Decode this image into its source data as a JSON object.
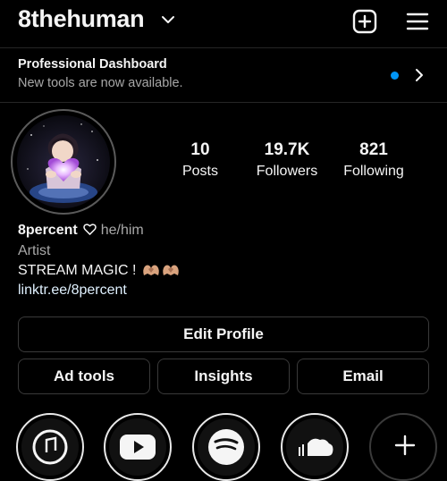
{
  "header": {
    "username": "8thehuman",
    "icons": [
      "chevron-down-icon",
      "add-icon",
      "menu-icon"
    ]
  },
  "dashboard": {
    "title": "Professional Dashboard",
    "subtitle": "New tools are now available.",
    "dot_color": "#0095f6"
  },
  "stats": [
    {
      "value": "10",
      "label": "Posts"
    },
    {
      "value": "19.7K",
      "label": "Followers"
    },
    {
      "value": "821",
      "label": "Following"
    }
  ],
  "bio": {
    "name": "8percent",
    "pronouns": "he/him",
    "category": "Artist",
    "text": "STREAM MAGIC !",
    "link": "linktr.ee/8percent"
  },
  "buttons": {
    "edit_profile": "Edit Profile",
    "ad_tools": "Ad tools",
    "insights": "Insights",
    "email": "Email"
  },
  "highlights": [
    "apple-music-icon",
    "youtube-icon",
    "spotify-icon",
    "soundcloud-icon",
    "new-highlight-icon"
  ],
  "colors": {
    "background": "#000000",
    "text": "#f5f5f5",
    "secondary": "#a8a8a8",
    "link": "#e0f1ff",
    "accent": "#0095f6"
  }
}
